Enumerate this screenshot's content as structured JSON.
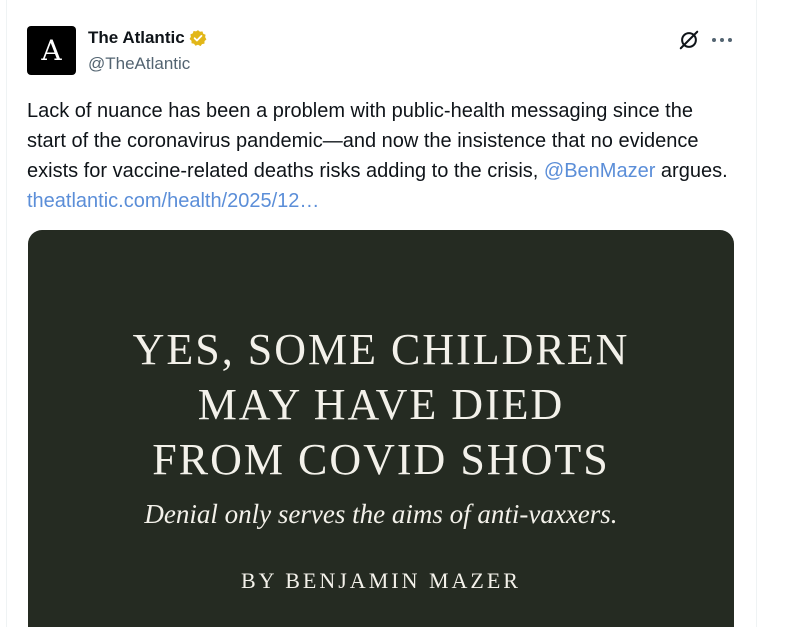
{
  "author": {
    "display_name": "The Atlantic",
    "handle": "@TheAtlantic",
    "avatar_letter": "A",
    "verified_color": "#e2b719"
  },
  "tweet": {
    "text_before": "Lack of nuance has been a problem with public-health messaging since the start of the coronavirus pandemic—and now the insistence that no evidence exists for vaccine-related deaths risks adding to the crisis, ",
    "mention": "@BenMazer",
    "text_middle": " argues. ",
    "link": "theatlantic.com/health/2025/12…"
  },
  "media": {
    "headline_lines": [
      "YES, SOME CHILDREN",
      "MAY HAVE DIED",
      "FROM COVID SHOTS"
    ],
    "dek": "Denial only serves the aims of anti-vaxxers.",
    "byline": "BY BENJAMIN MAZER"
  },
  "icons": {
    "grok": "grok-icon",
    "more": "more-icon",
    "verified": "verified-badge-icon"
  },
  "colors": {
    "link": "#5b8ed8",
    "media_bg": "#252b22",
    "text_secondary": "#536471"
  }
}
